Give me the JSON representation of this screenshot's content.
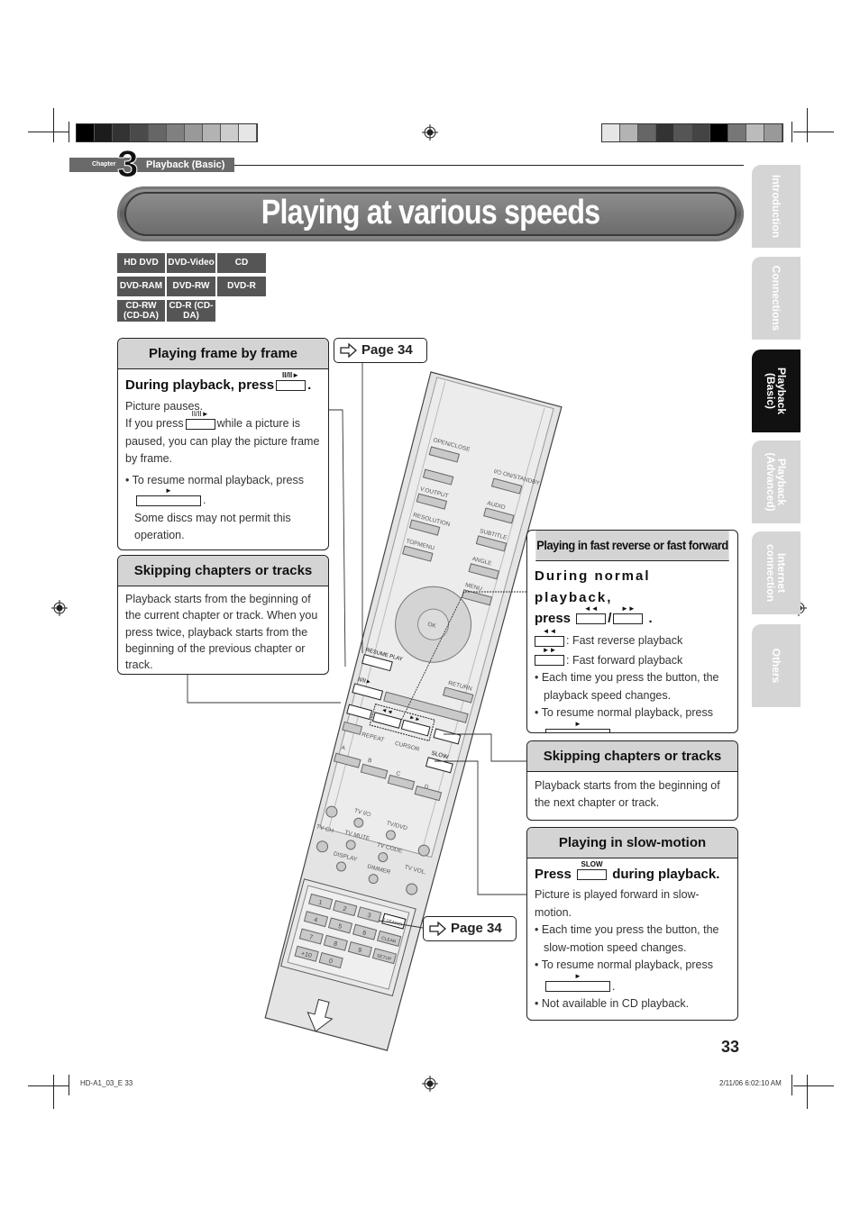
{
  "header": {
    "chapter_label": "Chapter",
    "chapter_number": "3",
    "chapter_name": "Playback (Basic)"
  },
  "title": "Playing at various speeds",
  "discs": [
    "HD DVD",
    "DVD-Video",
    "CD",
    "DVD-RAM",
    "DVD-RW",
    "DVD-R",
    "CD-RW (CD-DA)",
    "CD-R (CD-DA)"
  ],
  "side_tabs": [
    {
      "label": "Introduction",
      "active": false
    },
    {
      "label": "Connections",
      "active": false
    },
    {
      "label": "Playback\n(Basic)",
      "active": true
    },
    {
      "label": "Playback\n(Advanced)",
      "active": false
    },
    {
      "label": "Internet\nconnection",
      "active": false
    },
    {
      "label": "Others",
      "active": false
    }
  ],
  "frame": {
    "heading": "Playing frame by frame",
    "lead": "During playback, press",
    "pause_icon": "II/II►",
    "p1": "Picture pauses.",
    "p2a": "If you press",
    "p2b": "while a picture is paused, you can play the picture frame by frame.",
    "b1": "• To resume normal playback, press",
    "play_icon": "►",
    "note": "Some discs may not permit this operation."
  },
  "skip_left": {
    "heading": "Skipping chapters or tracks",
    "text": "Playback starts from the beginning of the current chapter or track. When you press twice, playback starts from the beginning of the previous chapter or track."
  },
  "pageref1": "Page 34",
  "pageref2": "Page 34",
  "fast": {
    "heading": "Playing in fast reverse or fast forward",
    "lead1": "During normal playback,",
    "lead2": "press",
    "rev_icon": "◄◄",
    "fwd_icon": "►►",
    "rev_text": ": Fast reverse playback",
    "fwd_text": ": Fast forward playback",
    "b1": "• Each time you press the button, the playback speed changes.",
    "b2": "• To resume normal playback, press",
    "play_icon": "►"
  },
  "skip_right": {
    "heading": "Skipping chapters or tracks",
    "text": "Playback starts from the beginning of the next chapter or track."
  },
  "slow": {
    "heading": "Playing in slow-motion",
    "lead_a": "Press",
    "slow_icon": "SLOW",
    "lead_b": "during playback.",
    "p1": "Picture is played forward in slow-motion.",
    "b1": "• Each time you press the button, the slow-motion speed changes.",
    "b2": "• To resume normal playback, press",
    "play_icon": "►",
    "b3": "• Not available in CD playback."
  },
  "remote": {
    "open_close": "OPEN/CLOSE",
    "on_standby": "I/⏻ ON/STANDBY",
    "voutput": "V.OUTPUT",
    "audio": "AUDIO",
    "resolution": "RESOLUTION",
    "subtitle": "SUBTITLE",
    "topmenu": "TOPMENU",
    "angle": "ANGLE",
    "menu": "MENU",
    "ok": "OK",
    "resume_play": "RESUME PLAY",
    "pause": "II/II►",
    "return": "RETURN",
    "repeat": "REPEAT",
    "cursor": "CURSOR",
    "slow": "SLOW",
    "a": "A",
    "b": "B",
    "c": "C",
    "d": "D",
    "tv_power": "TV I/⏻",
    "tv_dvd": "TV/DVD",
    "tv_ch": "TV CH",
    "tv_mute": "TV MUTE",
    "tv_code": "TV CODE",
    "tv_vol": "TV VOL.",
    "display": "DISPLAY",
    "dimmer": "DIMMER",
    "keys": [
      "1",
      "2",
      "3",
      "T.SEARCH",
      "4",
      "5",
      "6",
      "CLEAR",
      "7",
      "8",
      "9",
      "SETUP",
      "+10",
      "0"
    ]
  },
  "page_number": "33",
  "footer": {
    "left": "HD-A1_03_E   33",
    "right": "2/11/06   6:02:10 AM"
  },
  "colors": {
    "bar_left": [
      "#000000",
      "#1a1a1a",
      "#333333",
      "#4d4d4d",
      "#666666",
      "#808080",
      "#999999",
      "#b3b3b3",
      "#cccccc",
      "#e6e6e6",
      "#ffffff"
    ],
    "header_gray": "#d4d4d4",
    "active_tab": "#111111",
    "inactive_tab": "#d5d5d5"
  }
}
